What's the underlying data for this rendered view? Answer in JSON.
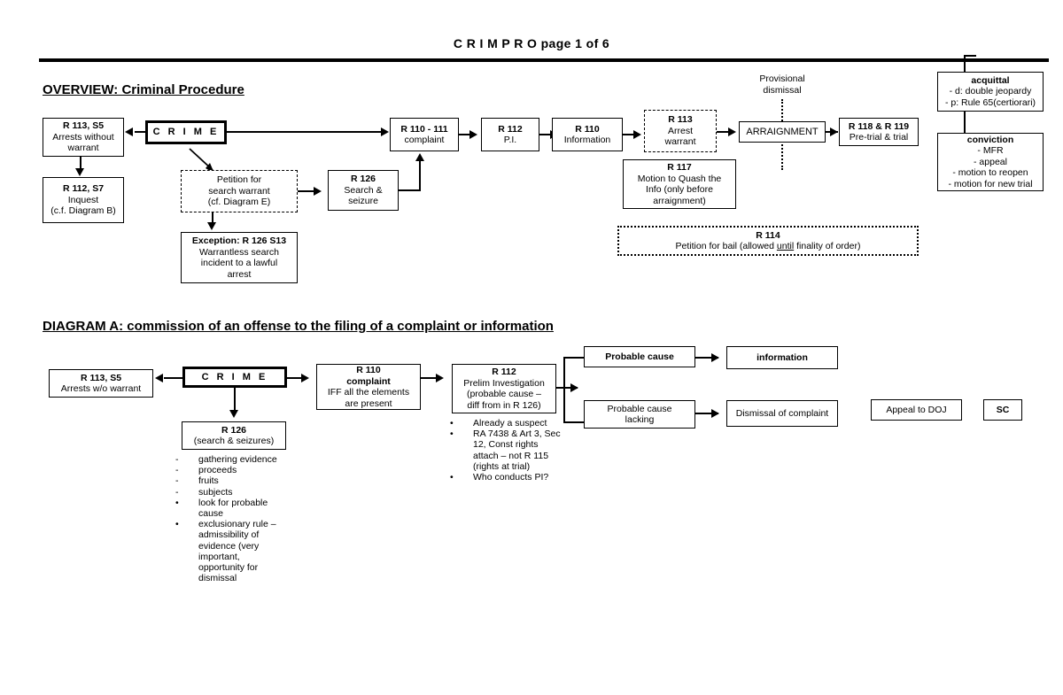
{
  "document": {
    "title": "C R I M P R O page 1 of 6"
  },
  "overview": {
    "heading": "OVERVIEW: Criminal Procedure",
    "boxes": {
      "arrests": {
        "title": "R 113, S5",
        "body": "Arrests without\nwarrant"
      },
      "inquest": {
        "title": "R 112, S7",
        "body": "Inquest\n(c.f. Diagram B)"
      },
      "crime": {
        "label": "C R I M E"
      },
      "petition_search_warrant": {
        "body": "Petition for\nsearch warrant\n(cf. Diagram E)"
      },
      "exception": {
        "title": "Exception: R 126 S13",
        "body": "Warrantless search\nincident to a lawful\narrest"
      },
      "search_seizure": {
        "title": "R 126",
        "body": "Search &\nseizure"
      },
      "complaint": {
        "title": "R 110 - 111",
        "body": "complaint"
      },
      "pi": {
        "title": "R 112",
        "body": "P.I."
      },
      "information": {
        "title": "R 110",
        "body": "Information"
      },
      "arrest_warrant": {
        "title": "R 113",
        "body": "Arrest\nwarrant"
      },
      "motion_quash": {
        "title": "R 117",
        "body": "Motion to Quash the\nInfo (only before\narraignment)"
      },
      "arraignment": {
        "label": "ARRAIGNMENT"
      },
      "pretrial": {
        "title": "R 118 & R 119",
        "body": "Pre-trial & trial"
      },
      "bail": {
        "title": "R 114",
        "body_pre": "Petition for bail (allowed ",
        "body_underline": "until",
        "body_post": " finality of order)"
      },
      "acquittal": {
        "title": "acquittal",
        "body": "- d: double jeopardy\n- p: Rule 65(certiorari)"
      },
      "conviction": {
        "title": "conviction",
        "body": "- MFR\n- appeal\n- motion to reopen\n- motion for new trial"
      }
    },
    "labels": {
      "provisional_dismissal": "Provisional\ndismissal"
    }
  },
  "diagram_a": {
    "heading": "DIAGRAM A: commission of an offense to the filing of a complaint or information",
    "boxes": {
      "arrests": {
        "title": "R 113, S5",
        "body": "Arrests w/o warrant"
      },
      "crime": {
        "label": "C R I M E"
      },
      "search_seizures": {
        "title": "R 126",
        "body": "(search & seizures)"
      },
      "complaint": {
        "title": "R 110",
        "subtitle": "complaint",
        "body": "IFF all the elements\nare present"
      },
      "prelim": {
        "title": "R 112",
        "body": "Prelim Investigation\n(probable cause –\ndiff from in R 126)"
      },
      "probable_cause": {
        "label": "Probable cause"
      },
      "probable_cause_lacking": {
        "label": "Probable cause\nlacking"
      },
      "information": {
        "label": "information"
      },
      "dismissal": {
        "label": "Dismissal of complaint"
      },
      "appeal_doj": {
        "label": "Appeal to DOJ"
      },
      "sc": {
        "label": "SC"
      }
    },
    "search_list": [
      {
        "marker": "-",
        "text": "gathering evidence"
      },
      {
        "marker": "-",
        "text": "proceeds"
      },
      {
        "marker": "-",
        "text": "fruits"
      },
      {
        "marker": "-",
        "text": "subjects"
      },
      {
        "marker": "•",
        "text": "look for probable cause"
      },
      {
        "marker": "•",
        "text": "exclusionary rule – admissibility of evidence (very important, opportunity for dismissal"
      }
    ],
    "prelim_list": [
      {
        "marker": "•",
        "text": "Already a suspect"
      },
      {
        "marker": "•",
        "text": "RA 7438 & Art 3, Sec 12, Const rights attach – not R 115 (rights at trial)"
      },
      {
        "marker": "•",
        "text": "Who conducts PI?"
      }
    ]
  }
}
